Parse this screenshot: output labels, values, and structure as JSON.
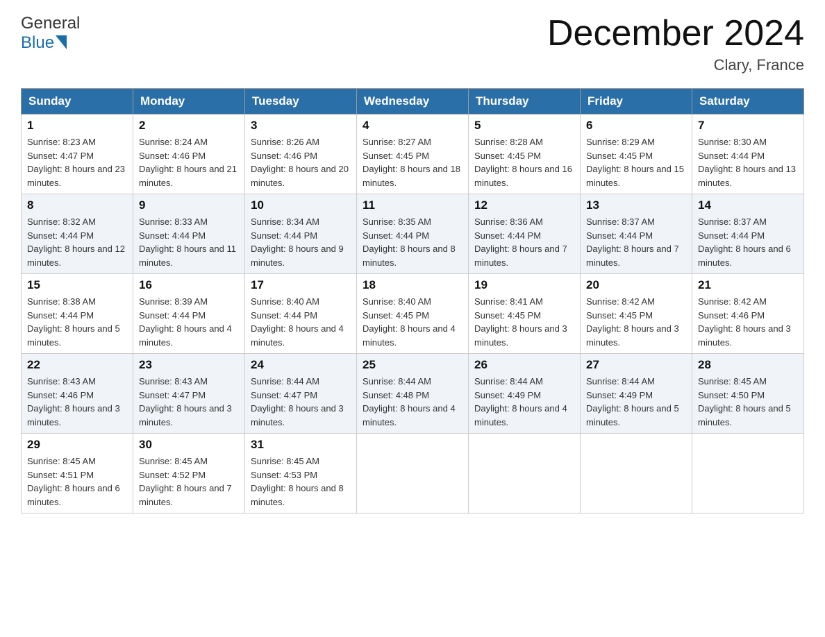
{
  "header": {
    "logo_general": "General",
    "logo_blue": "Blue",
    "title": "December 2024",
    "location": "Clary, France"
  },
  "columns": [
    "Sunday",
    "Monday",
    "Tuesday",
    "Wednesday",
    "Thursday",
    "Friday",
    "Saturday"
  ],
  "weeks": [
    [
      {
        "day": "1",
        "sunrise": "8:23 AM",
        "sunset": "4:47 PM",
        "daylight": "8 hours and 23 minutes."
      },
      {
        "day": "2",
        "sunrise": "8:24 AM",
        "sunset": "4:46 PM",
        "daylight": "8 hours and 21 minutes."
      },
      {
        "day": "3",
        "sunrise": "8:26 AM",
        "sunset": "4:46 PM",
        "daylight": "8 hours and 20 minutes."
      },
      {
        "day": "4",
        "sunrise": "8:27 AM",
        "sunset": "4:45 PM",
        "daylight": "8 hours and 18 minutes."
      },
      {
        "day": "5",
        "sunrise": "8:28 AM",
        "sunset": "4:45 PM",
        "daylight": "8 hours and 16 minutes."
      },
      {
        "day": "6",
        "sunrise": "8:29 AM",
        "sunset": "4:45 PM",
        "daylight": "8 hours and 15 minutes."
      },
      {
        "day": "7",
        "sunrise": "8:30 AM",
        "sunset": "4:44 PM",
        "daylight": "8 hours and 13 minutes."
      }
    ],
    [
      {
        "day": "8",
        "sunrise": "8:32 AM",
        "sunset": "4:44 PM",
        "daylight": "8 hours and 12 minutes."
      },
      {
        "day": "9",
        "sunrise": "8:33 AM",
        "sunset": "4:44 PM",
        "daylight": "8 hours and 11 minutes."
      },
      {
        "day": "10",
        "sunrise": "8:34 AM",
        "sunset": "4:44 PM",
        "daylight": "8 hours and 9 minutes."
      },
      {
        "day": "11",
        "sunrise": "8:35 AM",
        "sunset": "4:44 PM",
        "daylight": "8 hours and 8 minutes."
      },
      {
        "day": "12",
        "sunrise": "8:36 AM",
        "sunset": "4:44 PM",
        "daylight": "8 hours and 7 minutes."
      },
      {
        "day": "13",
        "sunrise": "8:37 AM",
        "sunset": "4:44 PM",
        "daylight": "8 hours and 7 minutes."
      },
      {
        "day": "14",
        "sunrise": "8:37 AM",
        "sunset": "4:44 PM",
        "daylight": "8 hours and 6 minutes."
      }
    ],
    [
      {
        "day": "15",
        "sunrise": "8:38 AM",
        "sunset": "4:44 PM",
        "daylight": "8 hours and 5 minutes."
      },
      {
        "day": "16",
        "sunrise": "8:39 AM",
        "sunset": "4:44 PM",
        "daylight": "8 hours and 4 minutes."
      },
      {
        "day": "17",
        "sunrise": "8:40 AM",
        "sunset": "4:44 PM",
        "daylight": "8 hours and 4 minutes."
      },
      {
        "day": "18",
        "sunrise": "8:40 AM",
        "sunset": "4:45 PM",
        "daylight": "8 hours and 4 minutes."
      },
      {
        "day": "19",
        "sunrise": "8:41 AM",
        "sunset": "4:45 PM",
        "daylight": "8 hours and 3 minutes."
      },
      {
        "day": "20",
        "sunrise": "8:42 AM",
        "sunset": "4:45 PM",
        "daylight": "8 hours and 3 minutes."
      },
      {
        "day": "21",
        "sunrise": "8:42 AM",
        "sunset": "4:46 PM",
        "daylight": "8 hours and 3 minutes."
      }
    ],
    [
      {
        "day": "22",
        "sunrise": "8:43 AM",
        "sunset": "4:46 PM",
        "daylight": "8 hours and 3 minutes."
      },
      {
        "day": "23",
        "sunrise": "8:43 AM",
        "sunset": "4:47 PM",
        "daylight": "8 hours and 3 minutes."
      },
      {
        "day": "24",
        "sunrise": "8:44 AM",
        "sunset": "4:47 PM",
        "daylight": "8 hours and 3 minutes."
      },
      {
        "day": "25",
        "sunrise": "8:44 AM",
        "sunset": "4:48 PM",
        "daylight": "8 hours and 4 minutes."
      },
      {
        "day": "26",
        "sunrise": "8:44 AM",
        "sunset": "4:49 PM",
        "daylight": "8 hours and 4 minutes."
      },
      {
        "day": "27",
        "sunrise": "8:44 AM",
        "sunset": "4:49 PM",
        "daylight": "8 hours and 5 minutes."
      },
      {
        "day": "28",
        "sunrise": "8:45 AM",
        "sunset": "4:50 PM",
        "daylight": "8 hours and 5 minutes."
      }
    ],
    [
      {
        "day": "29",
        "sunrise": "8:45 AM",
        "sunset": "4:51 PM",
        "daylight": "8 hours and 6 minutes."
      },
      {
        "day": "30",
        "sunrise": "8:45 AM",
        "sunset": "4:52 PM",
        "daylight": "8 hours and 7 minutes."
      },
      {
        "day": "31",
        "sunrise": "8:45 AM",
        "sunset": "4:53 PM",
        "daylight": "8 hours and 8 minutes."
      },
      null,
      null,
      null,
      null
    ]
  ]
}
